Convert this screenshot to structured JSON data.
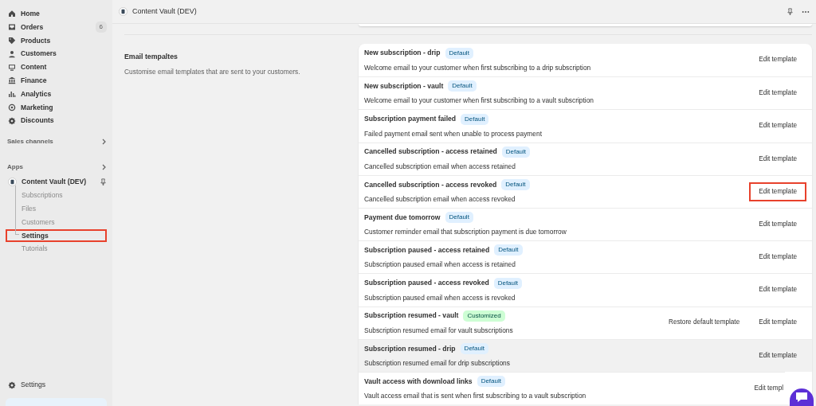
{
  "sidebar": {
    "nav": [
      {
        "label": "Home"
      },
      {
        "label": "Orders",
        "badge": "6"
      },
      {
        "label": "Products"
      },
      {
        "label": "Customers"
      },
      {
        "label": "Content"
      },
      {
        "label": "Finance"
      },
      {
        "label": "Analytics"
      },
      {
        "label": "Marketing"
      },
      {
        "label": "Discounts"
      }
    ],
    "sections": [
      {
        "label": "Sales channels"
      },
      {
        "label": "Apps"
      }
    ],
    "app": {
      "label": "Content Vault (DEV)",
      "children": [
        {
          "label": "Subscriptions",
          "selected": false,
          "highlighted": false
        },
        {
          "label": "Files",
          "selected": false,
          "highlighted": false
        },
        {
          "label": "Customers",
          "selected": false,
          "highlighted": false
        },
        {
          "label": "Settings",
          "selected": true,
          "highlighted": true
        },
        {
          "label": "Tutorials",
          "selected": false,
          "highlighted": false
        }
      ]
    },
    "footer": {
      "label": "Settings"
    }
  },
  "header": {
    "title": "Content Vault (DEV)"
  },
  "section": {
    "title": "Email tempaltes",
    "description": "Customise email templates that are sent to your customers."
  },
  "templates": [
    {
      "name": "New subscription - drip",
      "badge": {
        "label": "Default",
        "kind": "default"
      },
      "description": "Welcome email to your customer when first subscribing to a drip subscription",
      "edit": "Edit template",
      "hovered": false,
      "highlighted": false
    },
    {
      "name": "New subscription - vault",
      "badge": {
        "label": "Default",
        "kind": "default"
      },
      "description": "Welcome email to your customer when first subscribing to a vault subscription",
      "edit": "Edit template",
      "hovered": false,
      "highlighted": false
    },
    {
      "name": "Subscription payment failed",
      "badge": {
        "label": "Default",
        "kind": "default"
      },
      "description": "Failed payment email sent when unable to process payment",
      "edit": "Edit template",
      "hovered": false,
      "highlighted": false
    },
    {
      "name": "Cancelled subscription - access retained",
      "badge": {
        "label": "Default",
        "kind": "default"
      },
      "description": "Cancelled subscription email when access retained",
      "edit": "Edit template",
      "hovered": false,
      "highlighted": false
    },
    {
      "name": "Cancelled subscription - access revoked",
      "badge": {
        "label": "Default",
        "kind": "default"
      },
      "description": "Cancelled subscription email when access revoked",
      "edit": "Edit template",
      "hovered": false,
      "highlighted": true
    },
    {
      "name": "Payment due tomorrow",
      "badge": {
        "label": "Default",
        "kind": "default"
      },
      "description": "Customer reminder email that subscription payment is due tomorrow",
      "edit": "Edit template",
      "hovered": false,
      "highlighted": false
    },
    {
      "name": "Subscription paused - access retained",
      "badge": {
        "label": "Default",
        "kind": "default"
      },
      "description": "Subscription paused email when access is retained",
      "edit": "Edit template",
      "hovered": false,
      "highlighted": false
    },
    {
      "name": "Subscription paused - access revoked",
      "badge": {
        "label": "Default",
        "kind": "default"
      },
      "description": "Subscription paused email when access is revoked",
      "edit": "Edit template",
      "hovered": false,
      "highlighted": false
    },
    {
      "name": "Subscription resumed - vault",
      "badge": {
        "label": "Customized",
        "kind": "customized"
      },
      "description": "Subscription resumed email for vault subscriptions",
      "restore": "Restore default template",
      "edit": "Edit template",
      "hovered": false,
      "highlighted": false
    },
    {
      "name": "Subscription resumed - drip",
      "badge": {
        "label": "Default",
        "kind": "default"
      },
      "description": "Subscription resumed email for drip subscriptions",
      "edit": "Edit template",
      "hovered": true,
      "highlighted": false
    },
    {
      "name": "Vault access with download links",
      "badge": {
        "label": "Default",
        "kind": "default"
      },
      "description": "Vault access email that is sent when first subscribing to a vault subscription",
      "edit": "Edit templ",
      "hovered": false,
      "highlighted": false
    }
  ]
}
